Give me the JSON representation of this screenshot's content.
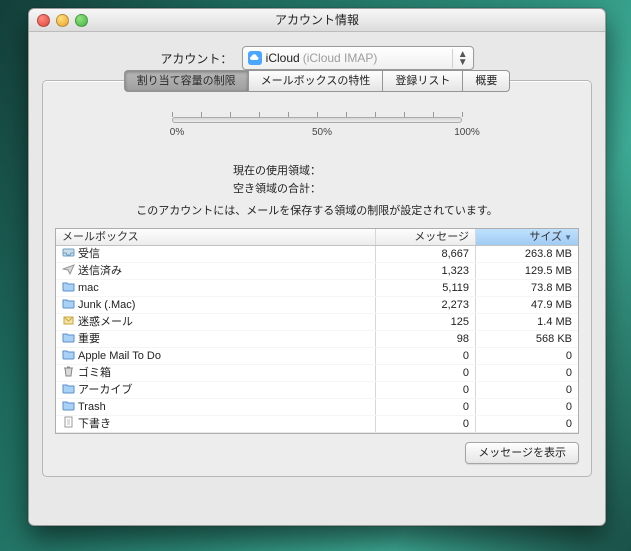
{
  "window": {
    "title": "アカウント情報"
  },
  "account": {
    "label": "アカウント：",
    "name": "iCloud",
    "detail": "(iCloud IMAP)"
  },
  "tabs": [
    {
      "label": "割り当て容量の制限",
      "active": true
    },
    {
      "label": "メールボックスの特性",
      "active": false
    },
    {
      "label": "登録リスト",
      "active": false
    },
    {
      "label": "概要",
      "active": false
    }
  ],
  "slider": {
    "ticks": [
      "0%",
      "50%",
      "100%"
    ]
  },
  "info": {
    "used_label": "現在の使用領域：",
    "free_label": "空き領域の合計：",
    "message": "このアカウントには、メールを保存する領域の制限が設定されています。"
  },
  "table": {
    "headers": {
      "name": "メールボックス",
      "messages": "メッセージ",
      "size": "サイズ"
    },
    "rows": [
      {
        "icon": "inbox",
        "name": "受信",
        "messages": "8,667",
        "size": "263.8 MB"
      },
      {
        "icon": "sent",
        "name": "送信済み",
        "messages": "1,323",
        "size": "129.5 MB"
      },
      {
        "icon": "folder",
        "name": "mac",
        "messages": "5,119",
        "size": "73.8 MB"
      },
      {
        "icon": "folder",
        "name": "Junk (.Mac)",
        "messages": "2,273",
        "size": "47.9 MB"
      },
      {
        "icon": "junk",
        "name": "迷惑メール",
        "messages": "125",
        "size": "1.4 MB"
      },
      {
        "icon": "folder",
        "name": "重要",
        "messages": "98",
        "size": "568 KB"
      },
      {
        "icon": "folder",
        "name": "Apple Mail To Do",
        "messages": "0",
        "size": "0"
      },
      {
        "icon": "trash",
        "name": "ゴミ箱",
        "messages": "0",
        "size": "0"
      },
      {
        "icon": "folder",
        "name": "アーカイブ",
        "messages": "0",
        "size": "0"
      },
      {
        "icon": "folder",
        "name": "Trash",
        "messages": "0",
        "size": "0"
      },
      {
        "icon": "drafts",
        "name": "下書き",
        "messages": "0",
        "size": "0"
      }
    ]
  },
  "buttons": {
    "show_messages": "メッセージを表示"
  }
}
